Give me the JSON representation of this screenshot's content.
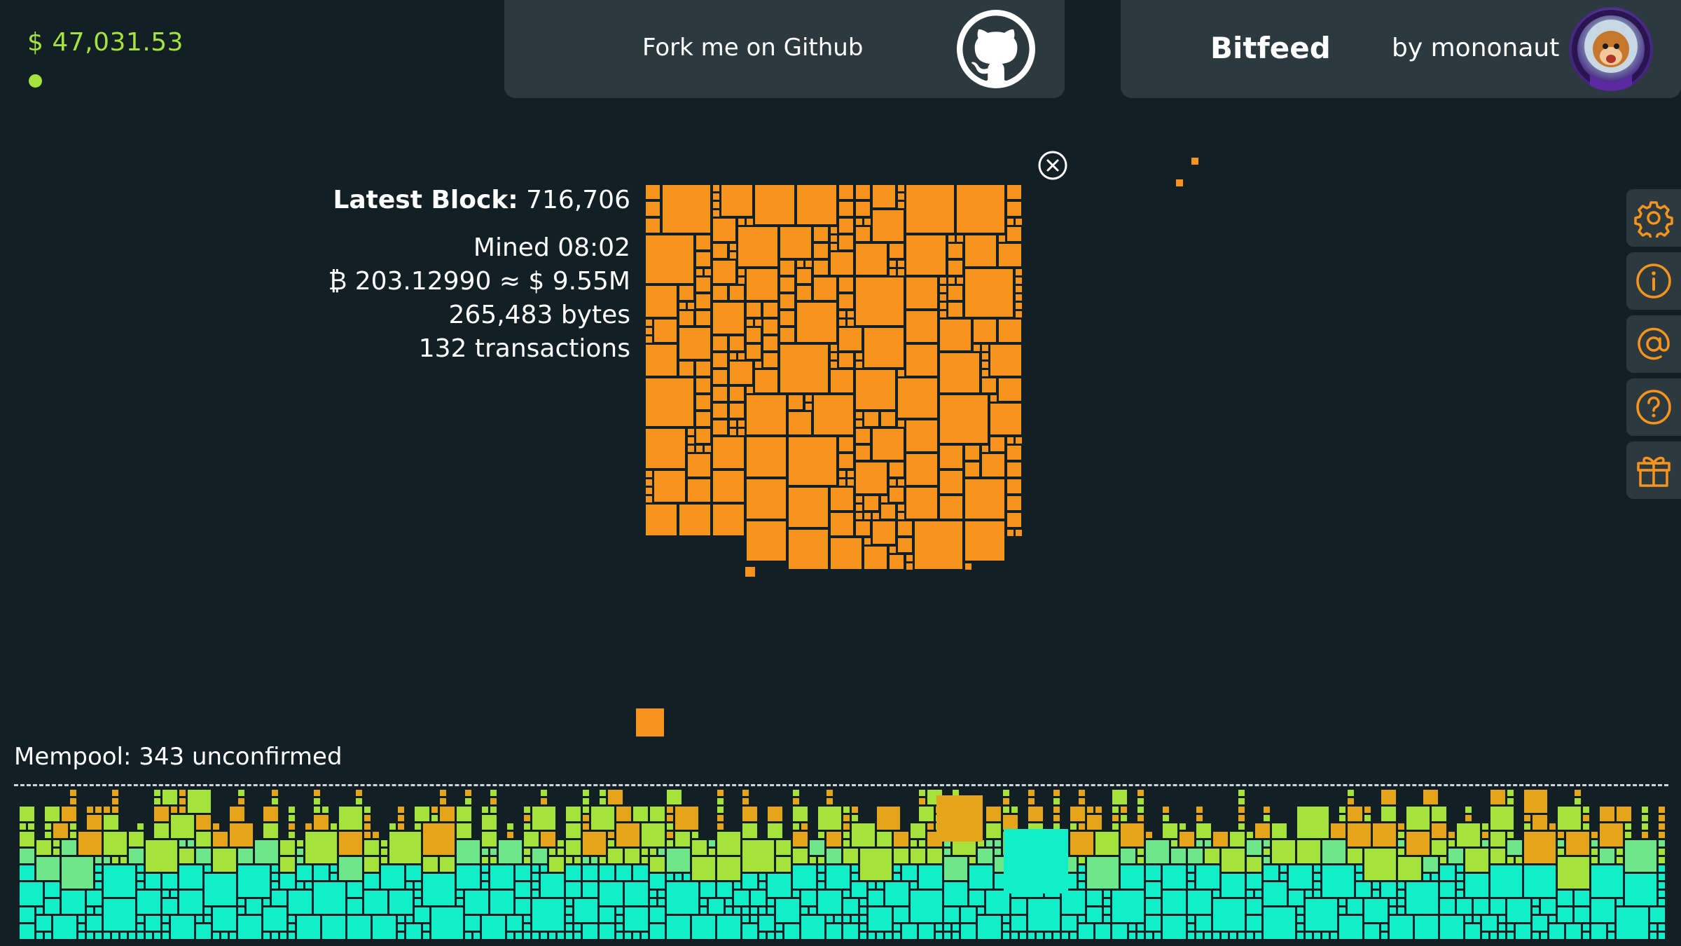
{
  "price": {
    "label": "$ 47,031.53",
    "status_color": "#a4e33d"
  },
  "github_banner": {
    "label": "Fork me on Github",
    "icon": "github-icon"
  },
  "author_banner": {
    "app_name": "Bitfeed",
    "byline": "by mononaut",
    "avatar_icon": "astronaut-monkey-avatar"
  },
  "latest_block": {
    "heading": "Latest Block:",
    "height": "716,706",
    "mined": "Mined 08:02",
    "value": "₿ 203.12990 ≈ $ 9.55M",
    "size": "265,483 bytes",
    "tx_count": "132 transactions",
    "close_icon": "close-circle-icon",
    "color": "#f7941d"
  },
  "side_menu": [
    {
      "name": "settings-button",
      "icon": "gear-icon"
    },
    {
      "name": "info-button",
      "icon": "info-icon"
    },
    {
      "name": "contact-button",
      "icon": "at-sign-icon"
    },
    {
      "name": "help-button",
      "icon": "question-icon"
    },
    {
      "name": "donate-button",
      "icon": "gift-icon"
    }
  ],
  "mempool": {
    "label": "Mempool: 343 unconfirmed",
    "colors": {
      "low_fee": "#0ff0c8",
      "mid_fee": "#a6e23c",
      "high_fee": "#e4a51a"
    }
  },
  "accent": "#f7941d"
}
